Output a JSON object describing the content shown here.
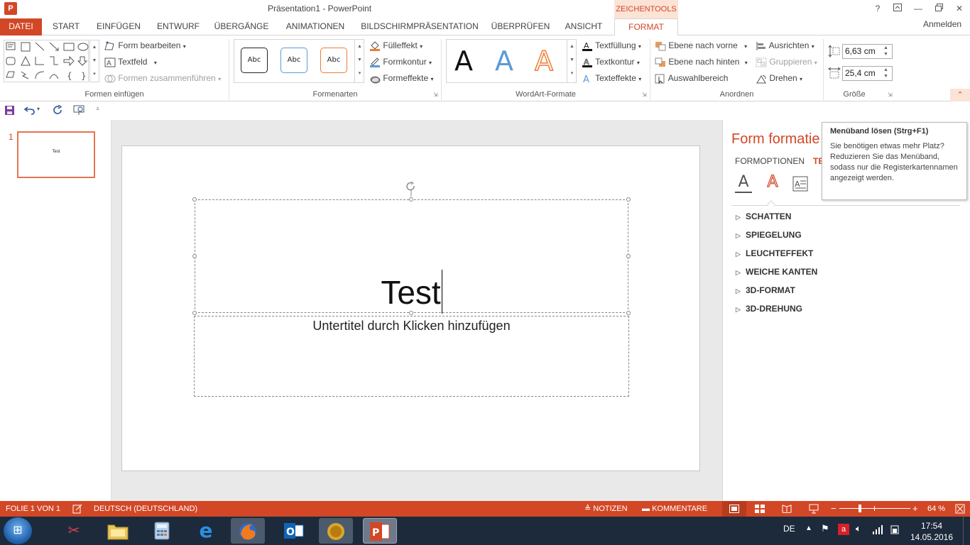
{
  "window": {
    "app_icon": "P",
    "title": "Präsentation1 - PowerPoint",
    "context_title": "ZEICHENTOOLS",
    "controls": [
      "?",
      "⧉",
      "—",
      "❐",
      "✕"
    ]
  },
  "tabs": {
    "datei": "DATEI",
    "start": "START",
    "einfuegen": "EINFÜGEN",
    "entwurf": "ENTWURF",
    "uebergaenge": "ÜBERGÄNGE",
    "animationen": "ANIMATIONEN",
    "bildschirm": "BILDSCHIRMPRÄSENTATION",
    "ueberpruefen": "ÜBERPRÜFEN",
    "ansicht": "ANSICHT",
    "format": "FORMAT",
    "anmelden": "Anmelden"
  },
  "ribbon": {
    "formen_einfuegen": {
      "label": "Formen einfügen",
      "form_bearbeiten": "Form bearbeiten",
      "textfeld": "Textfeld",
      "formen_zusammenfuehren": "Formen zusammenführen"
    },
    "formenarten": {
      "label": "Formenarten",
      "style_samples": [
        "Abc",
        "Abc",
        "Abc"
      ],
      "fuelleffekt": "Fülleffekt",
      "formkontur": "Formkontur",
      "formeffekte": "Formeffekte"
    },
    "wordart": {
      "label": "WordArt-Formate",
      "samples": [
        "A",
        "A",
        "A"
      ],
      "textfuellung": "Textfüllung",
      "textkontur": "Textkontur",
      "texteffekte": "Texteffekte"
    },
    "anordnen": {
      "label": "Anordnen",
      "ebene_vorne": "Ebene nach vorne",
      "ebene_hinten": "Ebene nach hinten",
      "auswahlbereich": "Auswahlbereich",
      "ausrichten": "Ausrichten",
      "gruppieren": "Gruppieren",
      "drehen": "Drehen"
    },
    "groesse": {
      "label": "Größe",
      "height": "6,63  cm",
      "width": "25,4  cm"
    }
  },
  "slides": {
    "number": "1",
    "thumb_text": "Test"
  },
  "slide": {
    "title_text": "Test",
    "subtitle_placeholder": "Untertitel durch Klicken hinzufügen"
  },
  "format_pane": {
    "title": "Form formatie",
    "tab_formoptionen": "FORMOPTIONEN",
    "tab_text": "TE",
    "sections": [
      "SCHATTEN",
      "SPIEGELUNG",
      "LEUCHTEFFEKT",
      "WEICHE KANTEN",
      "3D-FORMAT",
      "3D-DREHUNG"
    ]
  },
  "tooltip": {
    "title": "Menüband lösen (Strg+F1)",
    "body": "Sie benötigen etwas mehr Platz? Reduzieren Sie das Menüband, sodass nur die Registerkartennamen angezeigt werden."
  },
  "statusbar": {
    "slide_info": "FOLIE 1 VON 1",
    "language": "DEUTSCH (DEUTSCHLAND)",
    "notizen": "NOTIZEN",
    "kommentare": "KOMMENTARE",
    "zoom_minus": "−",
    "zoom_plus": "+",
    "zoom_value": "64 %",
    "zoom_level": 0.64
  },
  "taskbar": {
    "lang": "DE",
    "time": "17:54",
    "date": "14.05.2016"
  },
  "colors": {
    "accent": "#d24726",
    "ribbon_bg": "#ffffff",
    "taskbar": "#1c2a3b"
  }
}
